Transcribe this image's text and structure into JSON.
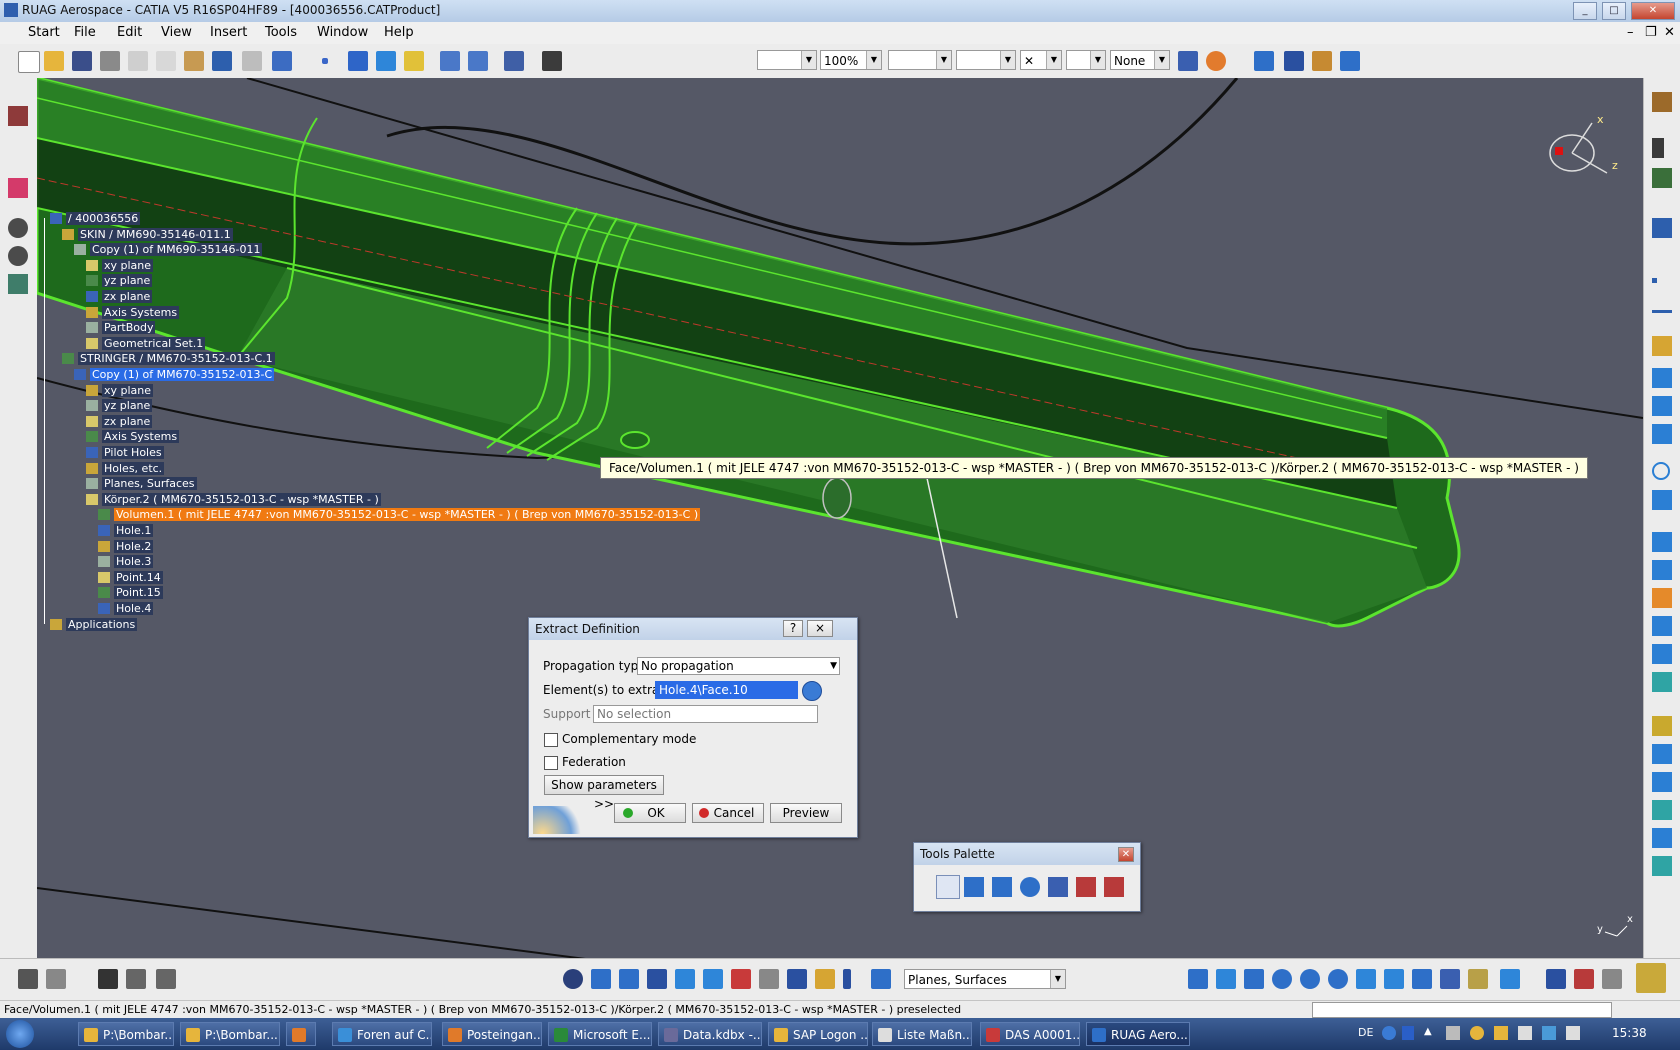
{
  "window": {
    "title": "RUAG Aerospace - CATIA V5 R16SP04HF89 - [400036556.CATProduct]"
  },
  "menu": [
    "Start",
    "File",
    "Edit",
    "View",
    "Insert",
    "Tools",
    "Window",
    "Help"
  ],
  "toolbar": {
    "zoom": "100%",
    "none_label": "None"
  },
  "tree": [
    {
      "label": "/ 400036556",
      "indent": 0,
      "style": "normal"
    },
    {
      "label": "SKIN / MM690-35146-011.1",
      "indent": 1,
      "style": "normal"
    },
    {
      "label": "Copy (1) of MM690-35146-011",
      "indent": 2,
      "style": "normal"
    },
    {
      "label": "xy plane",
      "indent": 3,
      "style": "normal"
    },
    {
      "label": "yz plane",
      "indent": 3,
      "style": "normal"
    },
    {
      "label": "zx plane",
      "indent": 3,
      "style": "normal"
    },
    {
      "label": "Axis Systems",
      "indent": 3,
      "style": "normal"
    },
    {
      "label": "PartBody",
      "indent": 3,
      "style": "normal"
    },
    {
      "label": "Geometrical Set.1",
      "indent": 3,
      "style": "normal"
    },
    {
      "label": "STRINGER / MM670-35152-013-C.1",
      "indent": 1,
      "style": "normal"
    },
    {
      "label": "Copy (1) of MM670-35152-013-C",
      "indent": 2,
      "style": "selected"
    },
    {
      "label": "xy plane",
      "indent": 3,
      "style": "normal"
    },
    {
      "label": "yz plane",
      "indent": 3,
      "style": "normal"
    },
    {
      "label": "zx plane",
      "indent": 3,
      "style": "normal"
    },
    {
      "label": "Axis Systems",
      "indent": 3,
      "style": "normal"
    },
    {
      "label": "Pilot Holes",
      "indent": 3,
      "style": "normal"
    },
    {
      "label": "Holes, etc.",
      "indent": 3,
      "style": "normal"
    },
    {
      "label": "Planes, Surfaces",
      "indent": 3,
      "style": "normal"
    },
    {
      "label": "Körper.2 ( MM670-35152-013-C - wsp *MASTER - )",
      "indent": 3,
      "style": "normal"
    },
    {
      "label": "Volumen.1 (  mit JELE 4747 :von MM670-35152-013-C - wsp *MASTER -  ) ( Brep von MM670-35152-013-C )",
      "indent": 4,
      "style": "highlight"
    },
    {
      "label": "Hole.1",
      "indent": 4,
      "style": "normal"
    },
    {
      "label": "Hole.2",
      "indent": 4,
      "style": "normal"
    },
    {
      "label": "Hole.3",
      "indent": 4,
      "style": "normal"
    },
    {
      "label": "Point.14",
      "indent": 4,
      "style": "normal"
    },
    {
      "label": "Point.15",
      "indent": 4,
      "style": "normal"
    },
    {
      "label": "Hole.4",
      "indent": 4,
      "style": "normal"
    },
    {
      "label": "Applications",
      "indent": 0,
      "style": "normal"
    }
  ],
  "tooltip": "Face/Volumen.1 (  mit JELE 4747 :von MM670-35152-013-C - wsp *MASTER -  ) ( Brep von MM670-35152-013-C )/Körper.2 ( MM670-35152-013-C - wsp *MASTER -  )",
  "extract_dialog": {
    "title": "Extract Definition",
    "help": "?",
    "close": "×",
    "propagation_label": "Propagation type:",
    "propagation_value": "No propagation",
    "elements_label": "Element(s) to extract",
    "elements_value": "Hole.4\\Face.10",
    "support_label": "Support :",
    "support_value": "No selection",
    "complementary_label": "Complementary mode",
    "federation_label": "Federation",
    "show_params": "Show parameters >>",
    "ok": "OK",
    "cancel": "Cancel",
    "preview": "Preview"
  },
  "tools_palette": {
    "title": "Tools Palette"
  },
  "bottom_toolbar": {
    "combo": "Planes, Surfaces"
  },
  "status": {
    "text": "Face/Volumen.1 (  mit JELE 4747 :von MM670-35152-013-C - wsp *MASTER -  ) ( Brep von MM670-35152-013-C )/Körper.2 ( MM670-35152-013-C - wsp *MASTER -  ) preselected"
  },
  "axis_labels": {
    "x": "x",
    "y": "y",
    "z": "z"
  },
  "taskbar": {
    "tasks": [
      "P:\\Bombar...",
      "P:\\Bombar...",
      "",
      "Foren auf C...",
      "Posteingan...",
      "Microsoft E...",
      "Data.kdbx -...",
      "SAP Logon ...",
      "Liste Maßn...",
      "DAS A0001...",
      "RUAG Aero..."
    ],
    "lang": "DE",
    "clock": "15:38"
  },
  "colors": {
    "green_fill": "#1f7a1f",
    "green_edge": "#5be52e",
    "highlight": "#f07a12",
    "selection": "#2a6be6"
  }
}
